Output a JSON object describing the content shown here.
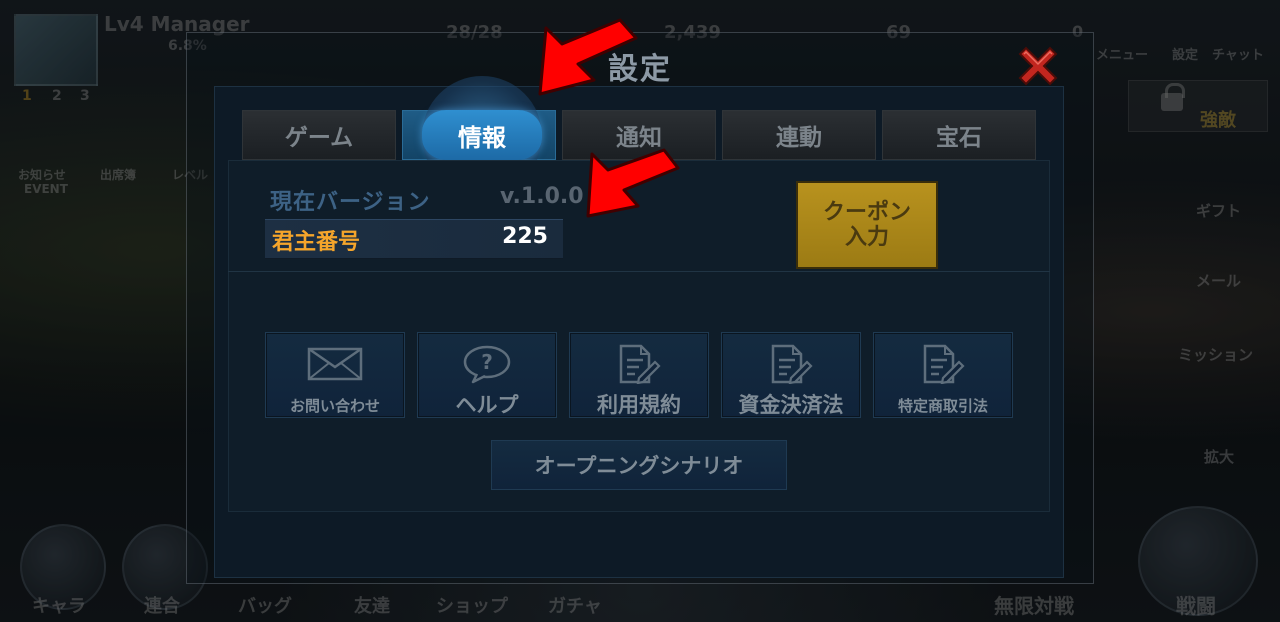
{
  "background": {
    "player_name": "Lv4 Manager",
    "exp_percent": "6.8%",
    "stamina": "28/28",
    "gold": "2,439",
    "gems": "69",
    "mail_count": "0",
    "menu_items": [
      "メニュー",
      "設定",
      "チャット"
    ],
    "left_items": [
      "お知らせ",
      "出席簿",
      "レベル"
    ],
    "event_label": "EVENT",
    "right_items": [
      "強敵",
      "ギフト",
      "メール",
      "ミッション",
      "拡大"
    ],
    "bottom_items": [
      "キャラ",
      "連合",
      "バッグ",
      "友達",
      "ショップ",
      "ガチャ"
    ],
    "infinite_battle": "無限対戦",
    "battle": "戦闘",
    "tiers": [
      "1",
      "2",
      "3"
    ]
  },
  "dialog": {
    "title": "設定",
    "tabs": [
      {
        "label": "ゲーム",
        "active": false
      },
      {
        "label": "情報",
        "active": true
      },
      {
        "label": "通知",
        "active": false
      },
      {
        "label": "連動",
        "active": false
      },
      {
        "label": "宝石",
        "active": false
      }
    ],
    "version_label": "現在バージョン",
    "version_value": "v.1.0.0",
    "lord_label": "君主番号",
    "lord_value": "225",
    "coupon_label": "クーポン\n入力",
    "buttons": [
      {
        "label": "お問い合わせ",
        "icon": "envelope-icon"
      },
      {
        "label": "ヘルプ",
        "icon": "question-bubble-icon"
      },
      {
        "label": "利用規約",
        "icon": "document-edit-icon"
      },
      {
        "label": "資金決済法",
        "icon": "document-edit-icon"
      },
      {
        "label": "特定商取引法",
        "icon": "document-edit-icon"
      }
    ],
    "opening_label": "オープニングシナリオ"
  },
  "colors": {
    "active_tab": "#1f6aa6",
    "lord_label": "#f5a52b",
    "coupon": "#b8921e",
    "annotation_arrow": "#ff0000"
  }
}
